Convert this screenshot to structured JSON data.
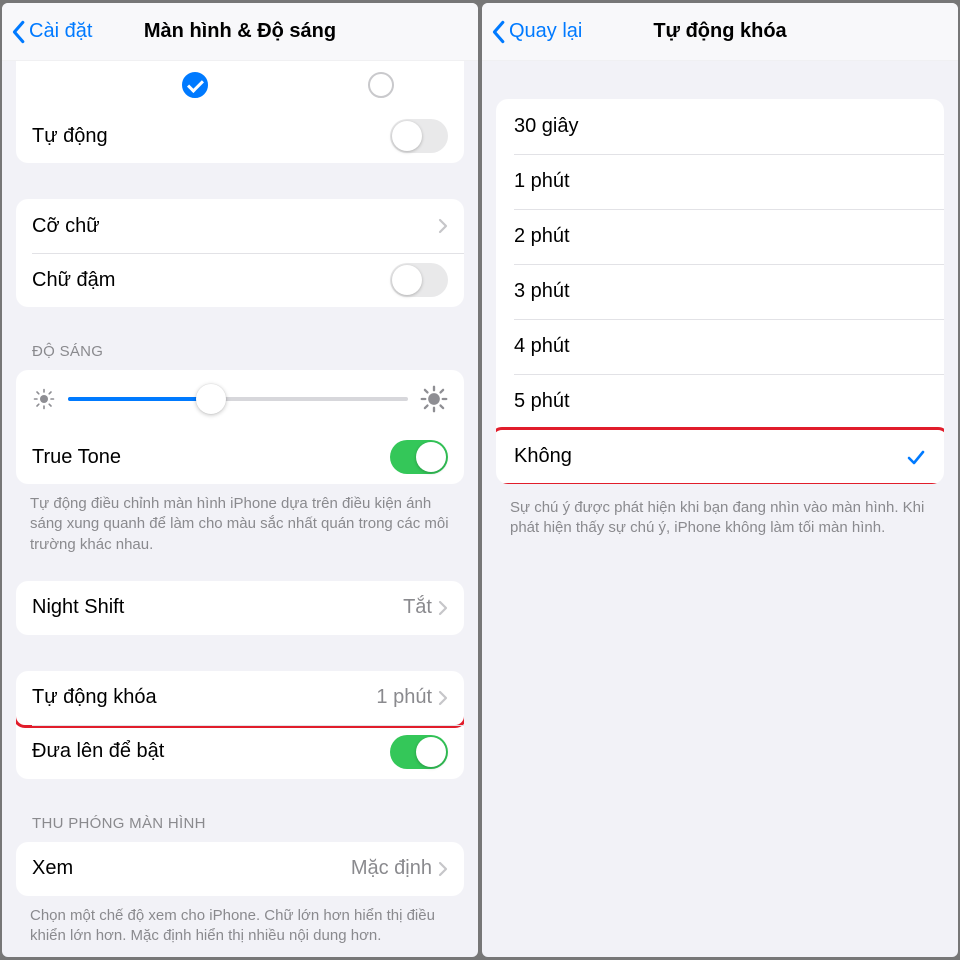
{
  "left": {
    "nav": {
      "back": "Cài đặt",
      "title": "Màn hình & Độ sáng"
    },
    "auto_row": {
      "label": "Tự động",
      "on": false
    },
    "text_group": {
      "size": "Cỡ chữ",
      "bold": {
        "label": "Chữ đậm",
        "on": false
      }
    },
    "brightness": {
      "header": "ĐỘ SÁNG",
      "value_pct": 42,
      "truetone": {
        "label": "True Tone",
        "on": true
      },
      "footer": "Tự động điều chỉnh màn hình iPhone dựa trên điều kiện ánh sáng xung quanh để làm cho màu sắc nhất quán trong các môi trường khác nhau."
    },
    "nightshift": {
      "label": "Night Shift",
      "value": "Tắt"
    },
    "autolock": {
      "label": "Tự động khóa",
      "value": "1 phút"
    },
    "raise": {
      "label": "Đưa lên để bật",
      "on": true
    },
    "zoom": {
      "header": "THU PHÓNG MÀN HÌNH",
      "label": "Xem",
      "value": "Mặc định",
      "footer": "Chọn một chế độ xem cho iPhone. Chữ lớn hơn hiển thị điều khiển lớn hơn. Mặc định hiển thị nhiều nội dung hơn."
    }
  },
  "right": {
    "nav": {
      "back": "Quay lại",
      "title": "Tự động khóa"
    },
    "options": [
      {
        "label": "30 giây",
        "selected": false
      },
      {
        "label": "1 phút",
        "selected": false
      },
      {
        "label": "2 phút",
        "selected": false
      },
      {
        "label": "3 phút",
        "selected": false
      },
      {
        "label": "4 phút",
        "selected": false
      },
      {
        "label": "5 phút",
        "selected": false
      },
      {
        "label": "Không",
        "selected": true
      }
    ],
    "footer": "Sự chú ý được phát hiện khi bạn đang nhìn vào màn hình. Khi phát hiện thấy sự chú ý, iPhone không làm tối màn hình."
  },
  "colors": {
    "accent": "#007aff",
    "green": "#34c759",
    "highlight": "#e11d2b"
  }
}
